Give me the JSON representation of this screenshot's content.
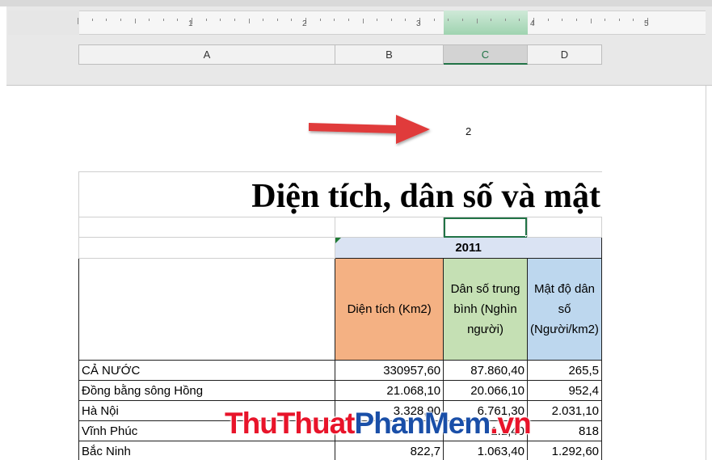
{
  "ruler": {
    "numbers": [
      "1",
      "2",
      "3",
      "4",
      "5"
    ]
  },
  "columns": [
    {
      "label": "A",
      "selected": false
    },
    {
      "label": "B",
      "selected": false
    },
    {
      "label": "C",
      "selected": true
    },
    {
      "label": "D",
      "selected": false
    }
  ],
  "page_number": "2",
  "sheet": {
    "title": "Diện tích, dân số và mật",
    "year_header": "2011",
    "col_headers": {
      "area": "Diện tích (Km2)",
      "population": "Dân số trung bình (Nghìn người)",
      "density": "Mật độ dân số (Người/km2)"
    },
    "rows": [
      {
        "name": "CẢ NƯỚC",
        "area": "330957,60",
        "population": "87.860,40",
        "density": "265,5"
      },
      {
        "name": "Đồng bằng sông Hồng",
        "area": "21.068,10",
        "population": "20.066,10",
        "density": "952,4"
      },
      {
        "name": "Hà Nội",
        "area": "3.328,90",
        "population": "6.761,30",
        "density": "2.031,10"
      },
      {
        "name": "Vĩnh Phúc",
        "area": "",
        "population": "1.1,40",
        "density": "818"
      },
      {
        "name": "Bắc Ninh",
        "area": "822,7",
        "population": "1.063,40",
        "density": "1.292,60"
      }
    ]
  },
  "watermark": {
    "part1": "ThuThuat",
    "part2": "PhanMem",
    "part3": ".vn"
  },
  "colors": {
    "accent": "#217346",
    "arrow": "#e03a3a",
    "area_header": "#f4b183",
    "population_header": "#c5e0b4",
    "density_header": "#bdd7ee",
    "year_header": "#dae3f3"
  }
}
